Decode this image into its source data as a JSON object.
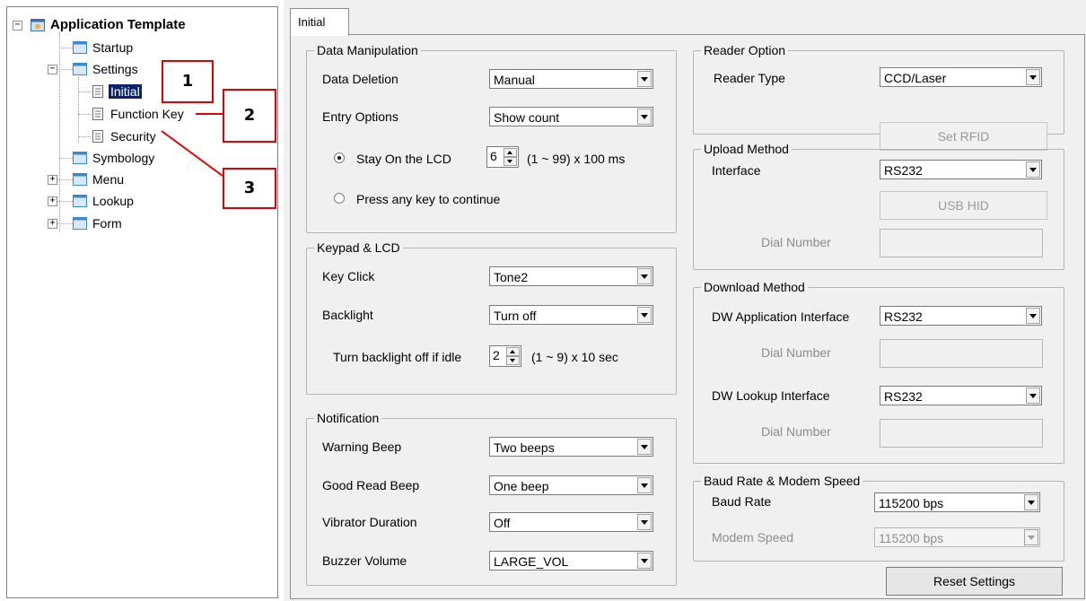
{
  "tree": {
    "root": {
      "label": "Application Template",
      "icon": "application-icon"
    },
    "items": [
      {
        "label": "Startup",
        "icon": "folder-page-icon"
      },
      {
        "label": "Settings",
        "icon": "folder-page-icon"
      },
      {
        "label": "Initial",
        "icon": "document-icon"
      },
      {
        "label": "Function Key",
        "icon": "document-icon"
      },
      {
        "label": "Security",
        "icon": "document-icon"
      },
      {
        "label": "Symbology",
        "icon": "folder-page-icon"
      },
      {
        "label": "Menu",
        "icon": "folder-page-icon"
      },
      {
        "label": "Lookup",
        "icon": "folder-page-icon"
      },
      {
        "label": "Form",
        "icon": "folder-page-icon"
      }
    ],
    "expanders": {
      "root": "−",
      "settings": "−",
      "menu": "+",
      "lookup": "+",
      "form": "+"
    }
  },
  "callouts": [
    "1",
    "2",
    "3"
  ],
  "tab": {
    "label": "Initial"
  },
  "data_manipulation": {
    "title": "Data Manipulation",
    "data_deletion_label": "Data Deletion",
    "data_deletion_value": "Manual",
    "entry_options_label": "Entry Options",
    "entry_options_value": "Show count",
    "stay_label": "Stay On the LCD",
    "stay_value": "6",
    "stay_range": "(1 ~ 99) x 100 ms",
    "press_key_label": "Press any key to continue"
  },
  "keypad": {
    "title": "Keypad & LCD",
    "key_click_label": "Key Click",
    "key_click_value": "Tone2",
    "backlight_label": "Backlight",
    "backlight_value": "Turn off",
    "idle_label": "Turn backlight off if idle",
    "idle_value": "2",
    "idle_range": "(1 ~ 9) x 10 sec"
  },
  "notification": {
    "title": "Notification",
    "warning_label": "Warning Beep",
    "warning_value": "Two beeps",
    "good_read_label": "Good Read Beep",
    "good_read_value": "One beep",
    "vibrator_label": "Vibrator Duration",
    "vibrator_value": "Off",
    "buzzer_label": "Buzzer Volume",
    "buzzer_value": "LARGE_VOL"
  },
  "reader": {
    "title": "Reader Option",
    "type_label": "Reader Type",
    "type_value": "CCD/Laser",
    "set_rfid": "Set RFID"
  },
  "upload": {
    "title": "Upload Method",
    "interface_label": "Interface",
    "interface_value": "RS232",
    "usb_hid": "USB HID",
    "dial_label": "Dial Number"
  },
  "download": {
    "title": "Download Method",
    "app_label": "DW Application Interface",
    "app_value": "RS232",
    "dial1_label": "Dial Number",
    "lookup_label": "DW Lookup Interface",
    "lookup_value": "RS232",
    "dial2_label": "Dial Number"
  },
  "baud": {
    "title": "Baud Rate & Modem Speed",
    "baud_label": "Baud Rate",
    "baud_value": "115200 bps",
    "modem_label": "Modem Speed",
    "modem_value": "115200 bps"
  },
  "reset_button": "Reset Settings"
}
